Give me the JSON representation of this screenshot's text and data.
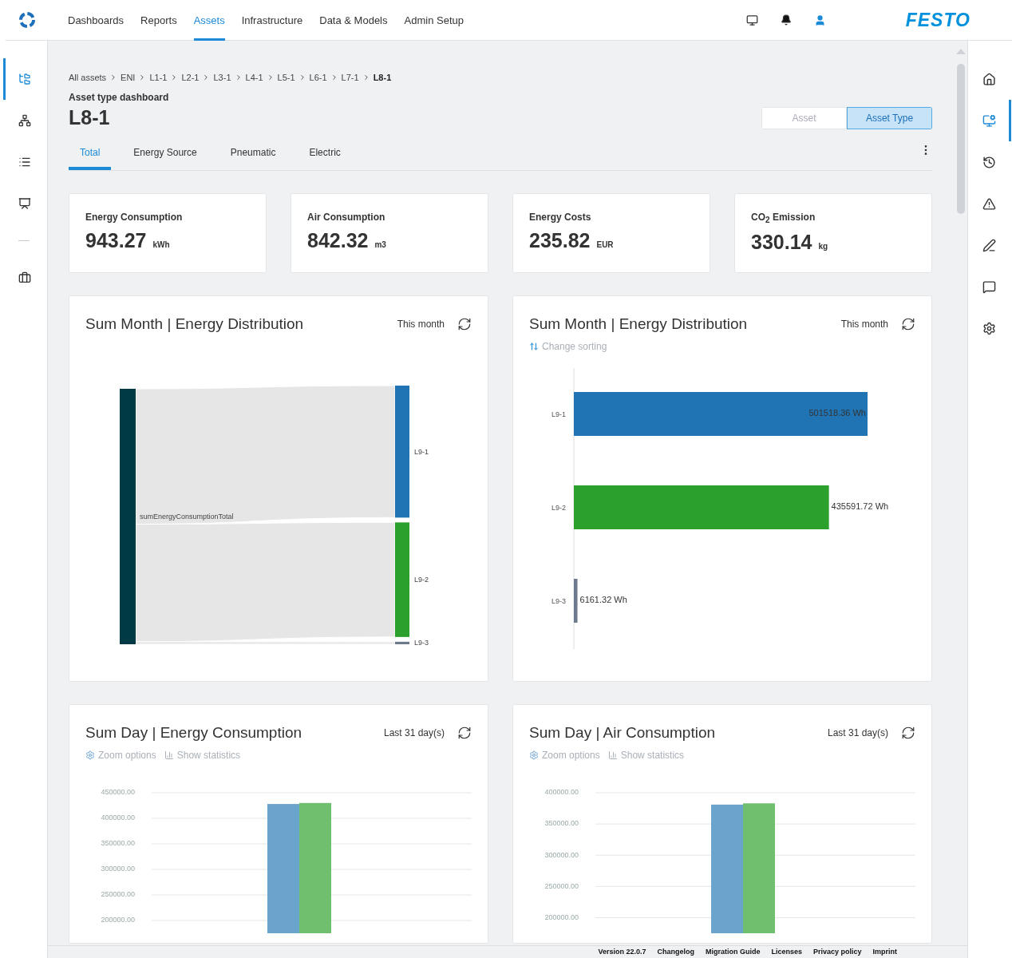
{
  "top_nav": {
    "items": [
      {
        "label": "Dashboards",
        "selected": false
      },
      {
        "label": "Reports",
        "selected": false
      },
      {
        "label": "Assets",
        "selected": true
      },
      {
        "label": "Infrastructure",
        "selected": false
      },
      {
        "label": "Data & Models",
        "selected": false
      },
      {
        "label": "Admin Setup",
        "selected": false
      }
    ],
    "brand": "FESTO"
  },
  "left_sidebar": {
    "items": [
      {
        "selected": true
      },
      {
        "selected": false
      },
      {
        "selected": false
      },
      {
        "selected": false
      },
      {
        "selected": false
      }
    ]
  },
  "right_sidebar": {
    "items": [
      {
        "selected": false
      },
      {
        "selected": true
      },
      {
        "selected": false
      },
      {
        "selected": false
      },
      {
        "selected": false
      },
      {
        "selected": false
      },
      {
        "selected": false
      }
    ]
  },
  "breadcrumb": [
    "All assets",
    "ENI",
    "L1-1",
    "L2-1",
    "L3-1",
    "L4-1",
    "L5-1",
    "L6-1",
    "L7-1",
    "L8-1"
  ],
  "subtitle": "Asset type dashboard",
  "title": "L8-1",
  "view_toggle": [
    {
      "label": "Asset",
      "selected": false
    },
    {
      "label": "Asset Type",
      "selected": true
    }
  ],
  "tabs": [
    {
      "label": "Total",
      "selected": true
    },
    {
      "label": "Energy Source",
      "selected": false
    },
    {
      "label": "Pneumatic",
      "selected": false
    },
    {
      "label": "Electric",
      "selected": false
    }
  ],
  "kpis": [
    {
      "label": "Energy Consumption",
      "value": "943.27",
      "unit": "kWh"
    },
    {
      "label": "Air Consumption",
      "value": "842.32",
      "unit": "m3"
    },
    {
      "label": "Energy Costs",
      "value": "235.82",
      "unit": "EUR"
    },
    {
      "label": "CO$_{2}$ Emission",
      "value": "330.14",
      "unit": "kg"
    }
  ],
  "distribution_sankey": {
    "title": "Sum Month | Energy Distribution",
    "period": "This month",
    "source": "sumEnergyConsumptionTotal",
    "targets": [
      {
        "label": "L9-1",
        "color": "#2074b4"
      },
      {
        "label": "L9-2",
        "color": "#2ca02c"
      },
      {
        "label": "L9-3",
        "color": "#6b7a8c"
      }
    ]
  },
  "distribution_bars": {
    "title": "Sum Month | Energy Distribution",
    "period": "This month",
    "sort_link": "Change sorting",
    "chart_data": {
      "type": "bar",
      "orientation": "horizontal",
      "stacked": true,
      "categories": [
        "L9-1",
        "L9-2",
        "L9-3"
      ],
      "series": [
        {
          "color": "#2074b4",
          "values": [
            501518.36,
            null,
            null
          ],
          "value_labels": [
            "501518.36 Wh",
            null,
            null
          ]
        },
        {
          "color": "#2ca02c",
          "values": [
            null,
            435591.72,
            null
          ],
          "value_labels": [
            null,
            "435591.72 Wh",
            null
          ]
        },
        {
          "color": "#6b7a8c",
          "values": [
            null,
            null,
            6161.32
          ],
          "value_labels": [
            null,
            null,
            "6161.32 Wh"
          ]
        }
      ]
    }
  },
  "daily_charts": [
    {
      "title": "Sum Day | Energy Consumption",
      "period": "Last 31 day(s)",
      "zoom_link": "Zoom options",
      "stats_link": "Show statistics",
      "chart_data": {
        "type": "bar",
        "categories": [
          null
        ],
        "grid": true,
        "ylim": [
          175000,
          450000
        ],
        "yticks": [
          {
            "value": 200000,
            "label": "200000.00"
          },
          {
            "value": 250000,
            "label": "250000.00"
          },
          {
            "value": 300000,
            "label": "300000.00"
          },
          {
            "value": 350000,
            "label": "350000.00"
          },
          {
            "value": 400000,
            "label": "400000.00"
          },
          {
            "value": 450000,
            "label": "450000.00"
          }
        ],
        "series": [
          {
            "color": "#6aa3cc",
            "values": [
              428000
            ]
          },
          {
            "color": "#6fbf6f",
            "values": [
              430000
            ]
          }
        ]
      }
    },
    {
      "title": "Sum Day | Air Consumption",
      "period": "Last 31 day(s)",
      "zoom_link": "Zoom options",
      "stats_link": "Show statistics",
      "chart_data": {
        "type": "bar",
        "categories": [
          null
        ],
        "grid": true,
        "ylim": [
          175000,
          400000
        ],
        "yticks": [
          {
            "value": 200000,
            "label": "200000.00"
          },
          {
            "value": 250000,
            "label": "250000.00"
          },
          {
            "value": 300000,
            "label": "300000.00"
          },
          {
            "value": 350000,
            "label": "350000.00"
          },
          {
            "value": 400000,
            "label": "400000.00"
          }
        ],
        "series": [
          {
            "color": "#6aa3cc",
            "values": [
              381000
            ]
          },
          {
            "color": "#6fbf6f",
            "values": [
              383000
            ]
          }
        ]
      }
    }
  ],
  "footer": [
    "Version 22.0.7",
    "Changelog",
    "Migration Guide",
    "Licenses",
    "Privacy policy",
    "Imprint"
  ]
}
